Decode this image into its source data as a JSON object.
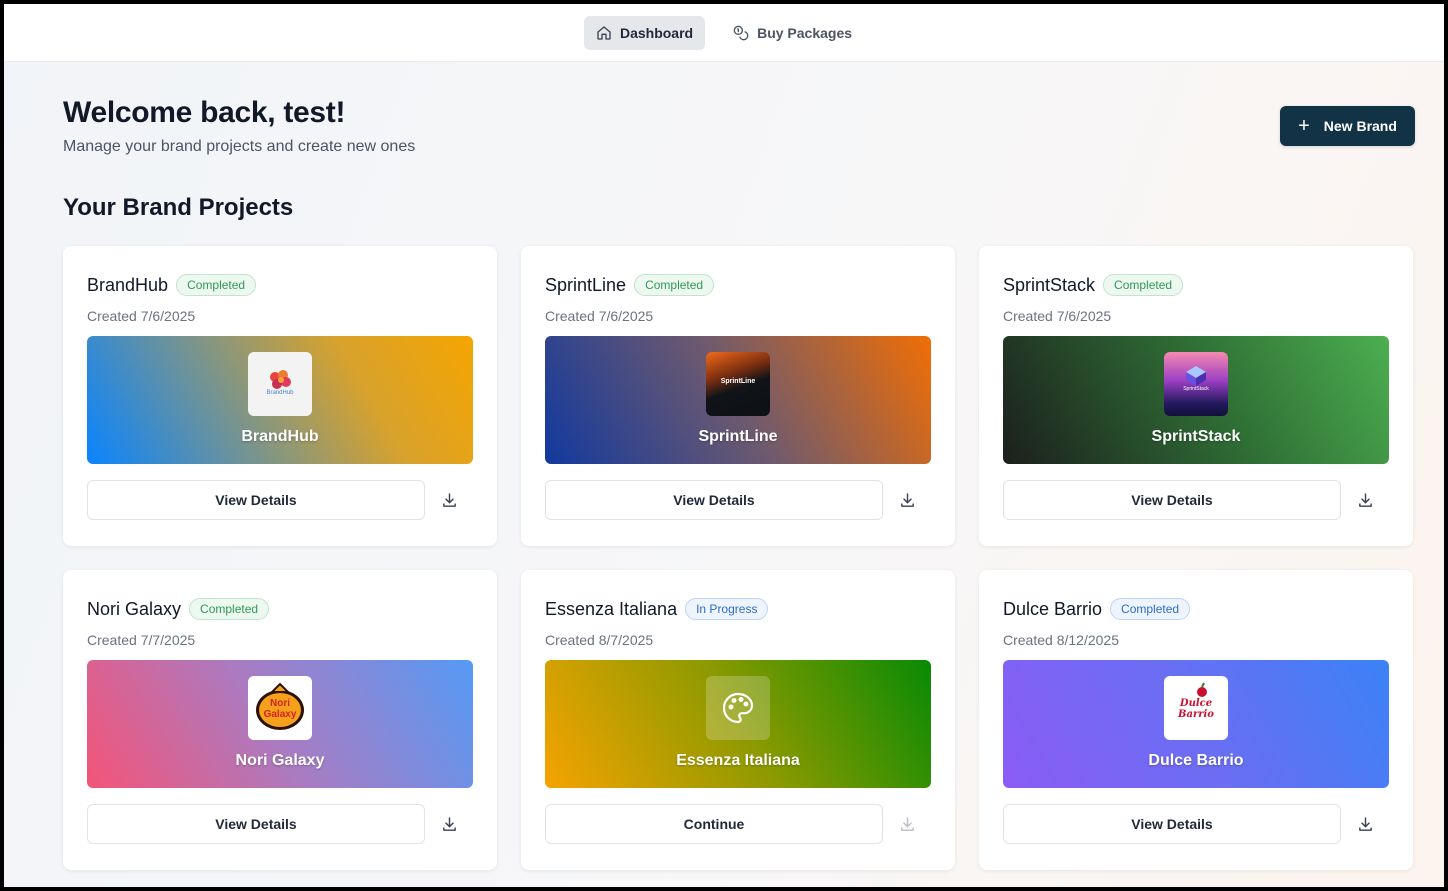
{
  "nav": {
    "dashboard": "Dashboard",
    "buy_packages": "Buy Packages"
  },
  "header": {
    "title": "Welcome back, test!",
    "subtitle": "Manage your brand projects and create new ones",
    "new_brand": "New Brand"
  },
  "section_title": "Your Brand Projects",
  "projects": [
    {
      "name": "BrandHub",
      "status": "Completed",
      "created": "Created 7/6/2025",
      "banner_name": "BrandHub",
      "action": "View Details",
      "logo_text": "BrandHub",
      "colors": [
        "#0a84ff",
        "#f5a500"
      ]
    },
    {
      "name": "SprintLine",
      "status": "Completed",
      "created": "Created 7/6/2025",
      "banner_name": "SprintLine",
      "action": "View Details",
      "logo_text": "SprintLine",
      "colors": [
        "#12399e",
        "#f06e05"
      ]
    },
    {
      "name": "SprintStack",
      "status": "Completed",
      "created": "Created 7/6/2025",
      "banner_name": "SprintStack",
      "action": "View Details",
      "logo_text": "SprintStack",
      "colors": [
        "#1c1f1d",
        "#4caf50"
      ]
    },
    {
      "name": "Nori Galaxy",
      "status": "Completed",
      "created": "Created 7/7/2025",
      "banner_name": "Nori Galaxy",
      "action": "View Details",
      "logo_text": "Nori Galaxy",
      "colors": [
        "#f45478",
        "#559af5"
      ]
    },
    {
      "name": "Essenza Italiana",
      "status": "In Progress",
      "created": "Created 8/7/2025",
      "banner_name": "Essenza Italiana",
      "action": "Continue",
      "logo_text": "",
      "colors": [
        "#f5a300",
        "#088a05"
      ]
    },
    {
      "name": "Dulce Barrio",
      "status": "Completed",
      "created": "Created 8/12/2025",
      "banner_name": "Dulce Barrio",
      "action": "View Details",
      "logo_text": "Dulce Barrio",
      "colors": [
        "#8b5cf6",
        "#3b82f6"
      ]
    }
  ],
  "icons": {
    "nav_dashboard": "home-icon",
    "nav_buy": "coins-icon",
    "new_brand": "plus-icon",
    "download": "download-icon",
    "palette": "palette-icon"
  }
}
